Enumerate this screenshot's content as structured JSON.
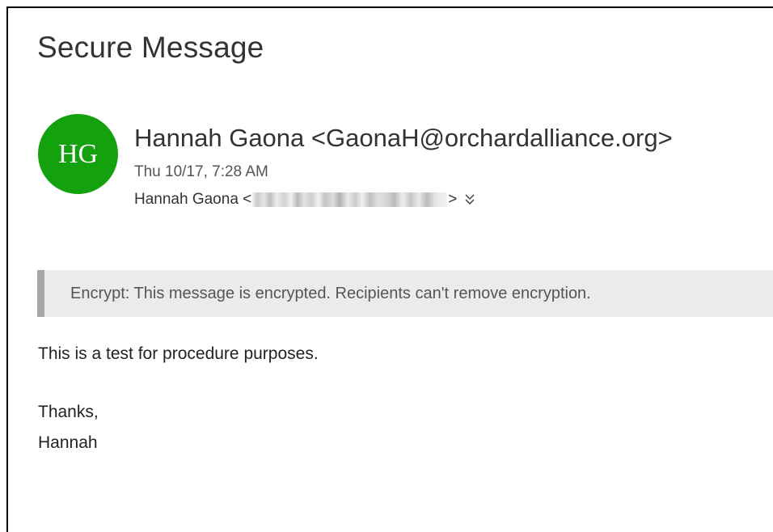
{
  "message": {
    "subject": "Secure Message",
    "sender": {
      "initials": "HG",
      "display": "Hannah Gaona <GaonaH@orchardalliance.org>",
      "avatar_color": "#13a10e"
    },
    "date": "Thu 10/17, 7:28 AM",
    "to": {
      "prefix": "Hannah Gaona <",
      "suffix": ">"
    },
    "expand_icon": "chevron-double-down-icon",
    "encryption_notice": "Encrypt: This message is encrypted. Recipients can't remove encryption.",
    "body": {
      "line1": "This is a test for procedure purposes.",
      "closing": "Thanks,",
      "signature": "Hannah"
    }
  }
}
